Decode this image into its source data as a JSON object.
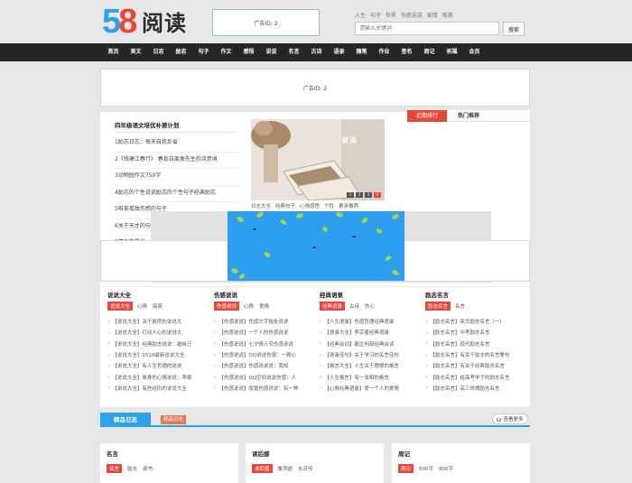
{
  "brand": {
    "logo_num": "58",
    "logo_text": "阅读",
    "logo_5": "5",
    "logo_8": "8"
  },
  "header": {
    "ad_label": "广告ID: 2",
    "tags": [
      "人生",
      "句子",
      "世界",
      "伤感说说",
      "爱情",
      "唯美"
    ],
    "search_placeholder": "请输入关键词",
    "search_button": "搜索"
  },
  "nav": [
    "首页",
    "美文",
    "日志",
    "励志",
    "句子",
    "作文",
    "感悟",
    "说说",
    "名言",
    "古诗",
    "语录",
    "随笔",
    "作业",
    "签名",
    "周记",
    "祝福",
    "会员"
  ],
  "banner_ad": "广告ID: 2",
  "featured": {
    "title": "四年级语文培优补差计划",
    "items": [
      "1励志日志：每天自我反省",
      "2《钱塘江春行》 春息自离类先生的诗意境",
      "3动物园作文750字",
      "4励志的个性说说励志的个性句子经典励志",
      "5唯美孤独伤感的句子",
      "6关于天才的句子",
      "7青春散是爱"
    ]
  },
  "slideshow": {
    "caption": "说说",
    "dots": [
      "1",
      "2",
      "3",
      "4"
    ],
    "active_dot": 3,
    "captions": [
      "日志大全",
      "经典句子",
      "心情感悟",
      "个性",
      "更多推荐"
    ]
  },
  "ranking": {
    "tab_active": "近期排行",
    "tab_other": "热门推荐"
  },
  "categories": [
    {
      "title": "说说大全",
      "tabs": [
        "说说大全",
        "心情",
        "搞笑"
      ],
      "items": [
        "【说说大全】关于厨房的说说大",
        "【说说大全】打动人心的说说大",
        "【说说大全】经典励志说说：越自己",
        "【说说大全】2019最新说说大全",
        "【说说大全】有人生哲理的说说",
        "【说说大全】单身的心情说说：孝顺",
        "【说说大全】有些经历的说说大全"
      ]
    },
    {
      "title": "伤感说说",
      "tabs": [
        "伤感说说",
        "心情",
        "爱情"
      ],
      "items": [
        "【伤感说说】伤感文字独处说说",
        "【伤感说说】一个人的伤感说说",
        "【伤感说说】七夕情人节伤感说说",
        "【伤感说说】QQ说说伤感：一颗心",
        "【伤感说说】伤感说说说：我知",
        "【伤感说说】QQ空间说说伤感：人",
        "【伤感说说】寂寞伤感说说：有一种"
      ]
    },
    {
      "title": "经典语录",
      "tabs": [
        "经典语录",
        "古诗",
        "伤心"
      ],
      "items": [
        "【人生语录】伤感哲理经典语录",
        "【语录大全】李宗盛经典语录",
        "【经典台词】霸主刑部经典台词",
        "【语录佳句】关于学习的名言佳句",
        "【格言大全】人生关于理想的格言",
        "【人生格言】有一张相的格言",
        "【心情经典语录】爱一个人的爱情"
      ]
    },
    {
      "title": "励志名言",
      "tabs": [
        "励志名言",
        "名言"
      ],
      "items": [
        "【励志名言】英文励志名言（一）",
        "【励志名言】中考励志名言",
        "【励志名言】现代励志名言",
        "【励志名言】有关于励志的名言警句",
        "【励志名言】有关于经典励志名言",
        "【励志名言】给高考学子的励志名言",
        "【励志名言】高三拼搏励志名言"
      ]
    }
  ],
  "diary": {
    "tab": "精品日志",
    "sub": "精品日志",
    "more": "查看更多"
  },
  "bottom_panels": [
    {
      "title": "名言",
      "tabs": [
        "名言",
        "励志",
        "读书"
      ]
    },
    {
      "title": "读后感",
      "tabs": [
        "读后感",
        "鲁滨逊",
        "水浒传"
      ]
    },
    {
      "title": "周记",
      "tabs": [
        "周记",
        "600字",
        "800字"
      ]
    }
  ]
}
